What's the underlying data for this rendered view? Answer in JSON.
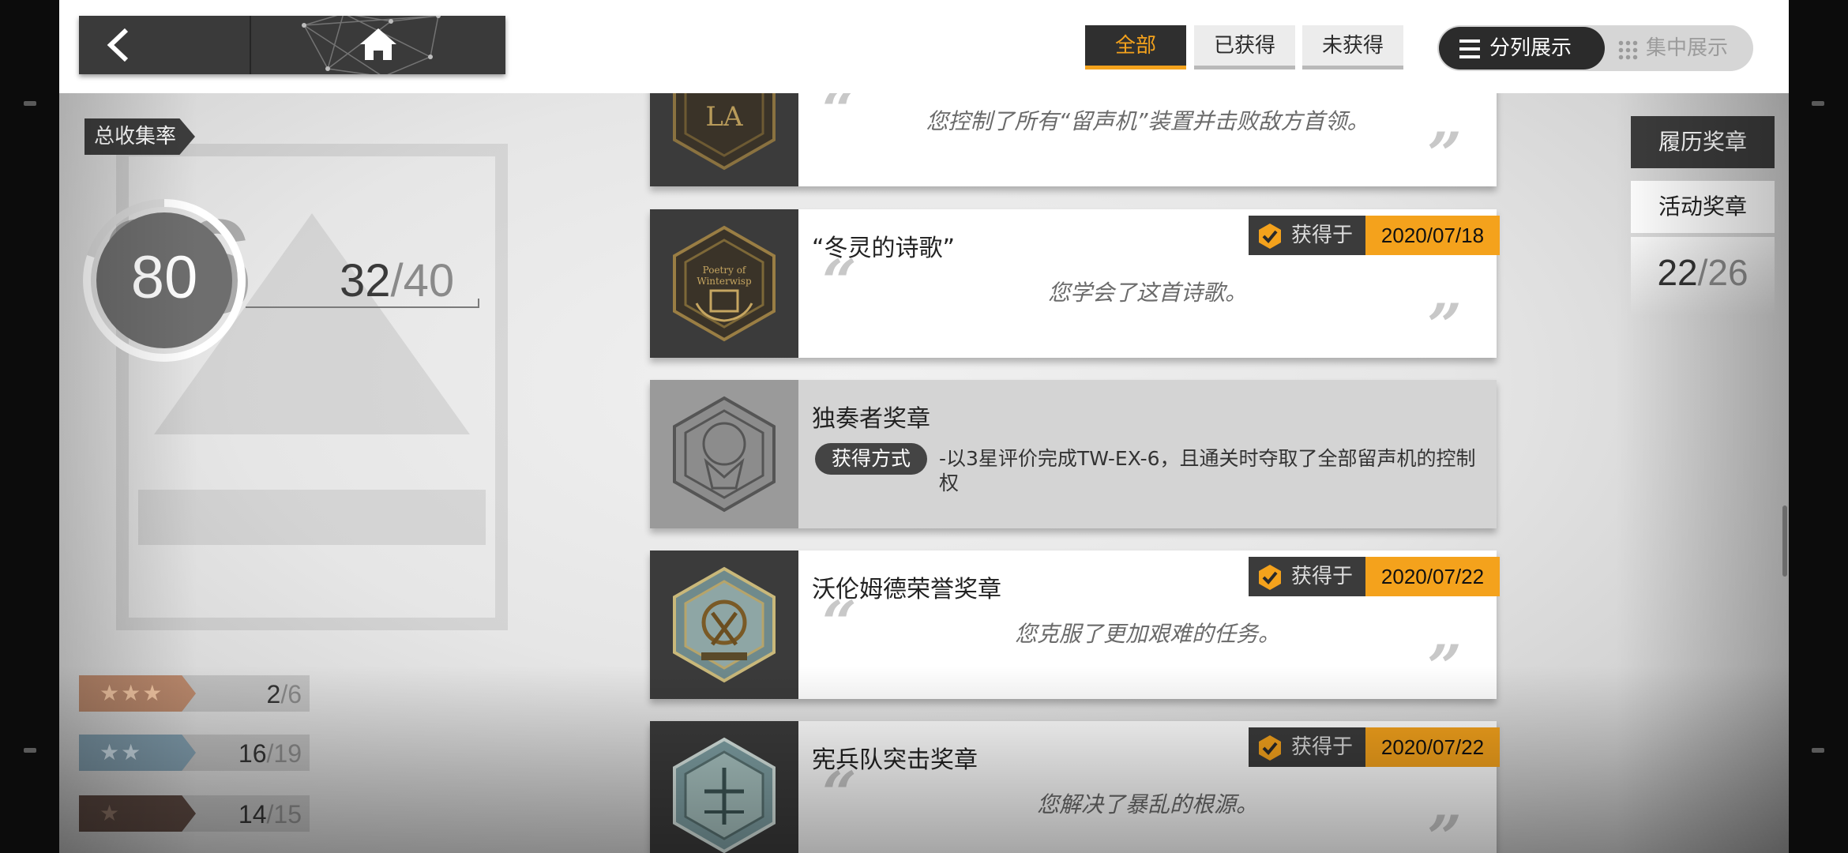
{
  "colors": {
    "accent": "#f4a21c",
    "dark": "#3b3b3b",
    "bronze": "#b8876b",
    "silver": "#7f9bab",
    "brown": "#5a4740"
  },
  "header": {
    "back_icon": "chevron-left-icon",
    "home_icon": "home-icon",
    "filters": [
      "全部",
      "已获得",
      "未获得"
    ],
    "active_filter": "全部",
    "view_modes": {
      "split": "分列展示",
      "focus": "集中展示"
    },
    "active_view": "分列展示"
  },
  "summary": {
    "label": "总收集率",
    "rate": "80",
    "rate_bg": "96",
    "rate_fraction": 0.8,
    "obtained": "32",
    "total": "40",
    "stars": [
      {
        "stars": "★★★",
        "obtained": "2",
        "total": "6"
      },
      {
        "stars": "★★",
        "obtained": "16",
        "total": "19"
      },
      {
        "stars": "★",
        "obtained": "14",
        "total": "15"
      }
    ]
  },
  "medals": [
    {
      "name": "",
      "quote": "您控制了所有“留声机”装置并击败敌方首领。",
      "obtained_label": "",
      "date": ""
    },
    {
      "name": "“冬灵的诗歌”",
      "quote": "您学会了这首诗歌。",
      "obtained_label": "获得于",
      "date": "2020/07/18"
    },
    {
      "name": "独奏者奖章",
      "method_label": "获得方式",
      "method": "-以3星评价完成TW-EX-6，且通关时夺取了全部留声机的控制权"
    },
    {
      "name": "沃伦姆德荣誉奖章",
      "quote": "您克服了更加艰难的任务。",
      "obtained_label": "获得于",
      "date": "2020/07/22"
    },
    {
      "name": "宪兵队突击奖章",
      "quote": "您解决了暴乱的根源。",
      "obtained_label": "获得于",
      "date": "2020/07/22"
    }
  ],
  "side": {
    "tabs": [
      "履历奖章",
      "活动奖章"
    ],
    "active_tab": "活动奖章",
    "obtained": "22",
    "total": "26"
  }
}
